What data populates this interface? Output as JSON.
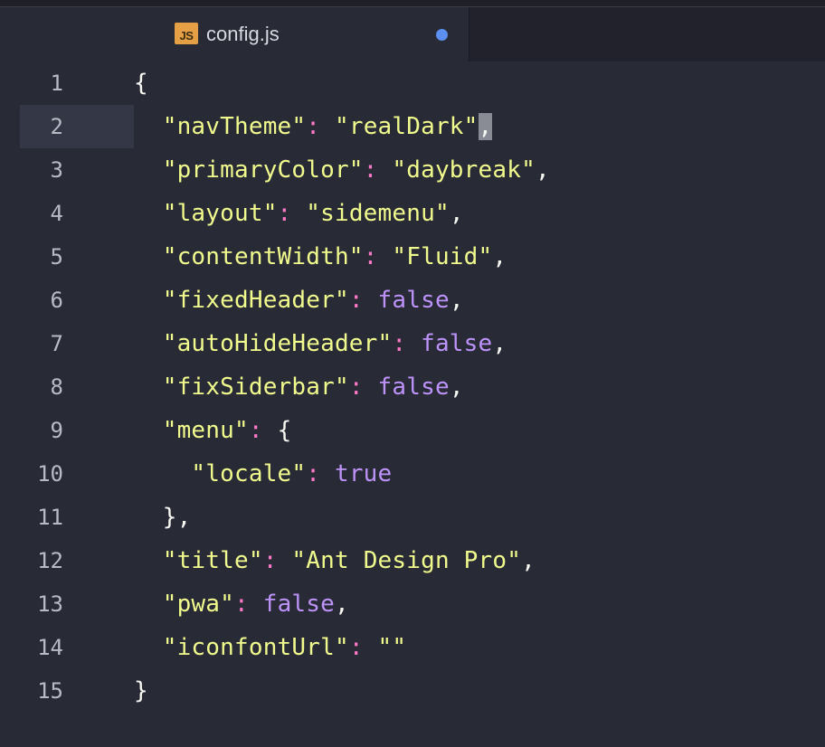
{
  "tab": {
    "icon_text": "JS",
    "filename": "config.js"
  },
  "line_numbers": [
    "1",
    "2",
    "3",
    "4",
    "5",
    "6",
    "7",
    "8",
    "9",
    "10",
    "11",
    "12",
    "13",
    "14",
    "15"
  ],
  "code": {
    "l1_open": "{",
    "l2_key": "\"navTheme\"",
    "l2_colon": ": ",
    "l2_val": "\"realDark\"",
    "l2_comma": ",",
    "l3_key": "\"primaryColor\"",
    "l3_colon": ": ",
    "l3_val": "\"daybreak\"",
    "l3_comma": ",",
    "l4_key": "\"layout\"",
    "l4_colon": ": ",
    "l4_val": "\"sidemenu\"",
    "l4_comma": ",",
    "l5_key": "\"contentWidth\"",
    "l5_colon": ": ",
    "l5_val": "\"Fluid\"",
    "l5_comma": ",",
    "l6_key": "\"fixedHeader\"",
    "l6_colon": ": ",
    "l6_val": "false",
    "l6_comma": ",",
    "l7_key": "\"autoHideHeader\"",
    "l7_colon": ": ",
    "l7_val": "false",
    "l7_comma": ",",
    "l8_key": "\"fixSiderbar\"",
    "l8_colon": ": ",
    "l8_val": "false",
    "l8_comma": ",",
    "l9_key": "\"menu\"",
    "l9_colon": ": ",
    "l9_brace": "{",
    "l10_key": "\"locale\"",
    "l10_colon": ": ",
    "l10_val": "true",
    "l11_close": "},",
    "l12_key": "\"title\"",
    "l12_colon": ": ",
    "l12_val": "\"Ant Design Pro\"",
    "l12_comma": ",",
    "l13_key": "\"pwa\"",
    "l13_colon": ": ",
    "l13_val": "false",
    "l13_comma": ",",
    "l14_key": "\"iconfontUrl\"",
    "l14_colon": ": ",
    "l14_val": "\"\"",
    "l15_close": "}"
  },
  "colors": {
    "background": "#282a36",
    "string": "#f1fa8c",
    "colon": "#ff79c6",
    "boolean": "#bd93f9",
    "modified_dot": "#5c8ff0",
    "js_icon": "#e5a045"
  },
  "icons": {
    "tab_file_icon": "js-file-icon",
    "modified_indicator": "unsaved-dot-icon"
  }
}
